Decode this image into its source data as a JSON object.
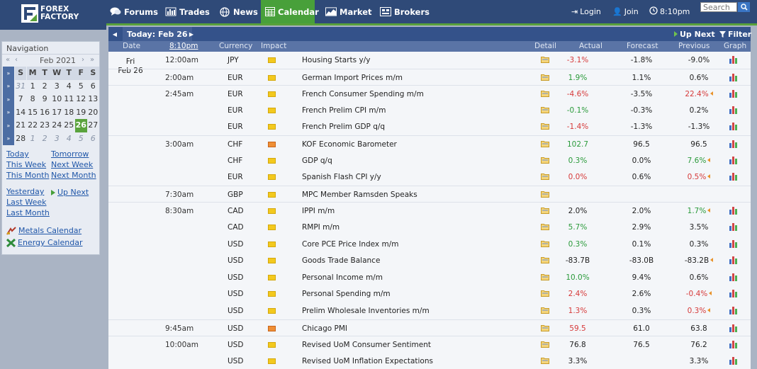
{
  "brand": {
    "line1": "FOREX",
    "line2": "FACTORY"
  },
  "nav": [
    {
      "label": "Forums",
      "icon": "chat-icon"
    },
    {
      "label": "Trades",
      "icon": "trades-icon"
    },
    {
      "label": "News",
      "icon": "globe-icon"
    },
    {
      "label": "Calendar",
      "icon": "calendar-icon",
      "active": true
    },
    {
      "label": "Market",
      "icon": "market-icon"
    },
    {
      "label": "Brokers",
      "icon": "brokers-icon"
    }
  ],
  "topright": {
    "login": "Login",
    "join": "Join",
    "clock": "8:10pm",
    "search_placeholder": "Search"
  },
  "sidebar": {
    "title": "Navigation",
    "month": "Feb 2021",
    "prev_year": "«",
    "prev_month": "‹",
    "next_month": "›",
    "next_year": "»",
    "weekday_headers": [
      "S",
      "M",
      "T",
      "W",
      "T",
      "F",
      "S"
    ],
    "weeks": [
      [
        {
          "d": "31",
          "dim": true
        },
        {
          "d": "1"
        },
        {
          "d": "2"
        },
        {
          "d": "3"
        },
        {
          "d": "4"
        },
        {
          "d": "5"
        },
        {
          "d": "6"
        }
      ],
      [
        {
          "d": "7"
        },
        {
          "d": "8"
        },
        {
          "d": "9"
        },
        {
          "d": "10"
        },
        {
          "d": "11"
        },
        {
          "d": "12"
        },
        {
          "d": "13"
        }
      ],
      [
        {
          "d": "14"
        },
        {
          "d": "15"
        },
        {
          "d": "16"
        },
        {
          "d": "17"
        },
        {
          "d": "18"
        },
        {
          "d": "19"
        },
        {
          "d": "20"
        }
      ],
      [
        {
          "d": "21"
        },
        {
          "d": "22"
        },
        {
          "d": "23"
        },
        {
          "d": "24"
        },
        {
          "d": "25"
        },
        {
          "d": "26",
          "today": true
        },
        {
          "d": "27"
        }
      ],
      [
        {
          "d": "28"
        },
        {
          "d": "1",
          "dim": true
        },
        {
          "d": "2",
          "dim": true
        },
        {
          "d": "3",
          "dim": true
        },
        {
          "d": "4",
          "dim": true
        },
        {
          "d": "5",
          "dim": true
        },
        {
          "d": "6",
          "dim": true
        }
      ]
    ],
    "links": {
      "today": "Today",
      "tomorrow": "Tomorrow",
      "this_week": "This Week",
      "next_week": "Next Week",
      "this_month": "This Month",
      "next_month": "Next Month",
      "yesterday": "Yesterday",
      "up_next": "Up Next",
      "last_week": "Last Week",
      "last_month": "Last Month",
      "metals": "Metals Calendar",
      "energy": "Energy Calendar"
    }
  },
  "calendar": {
    "today_label": "Today: Feb 26",
    "up_next": "Up Next",
    "filter": "Filter",
    "columns": {
      "date": "Date",
      "time": "8:10pm",
      "currency": "Currency",
      "impact": "Impact",
      "detail": "Detail",
      "actual": "Actual",
      "forecast": "Forecast",
      "previous": "Previous",
      "graph": "Graph"
    },
    "day_name": "Fri",
    "day_date": "Feb 26",
    "rows": [
      {
        "time": "12:00am",
        "cur": "JPY",
        "impact": "low",
        "event": "Housing Starts y/y",
        "actual": "-3.1%",
        "actual_color": "neg",
        "forecast": "-1.8%",
        "previous": "-9.0%",
        "prev_color": "",
        "revised": false
      },
      {
        "time": "2:00am",
        "cur": "EUR",
        "impact": "low",
        "event": "German Import Prices m/m",
        "actual": "1.9%",
        "actual_color": "pos",
        "forecast": "1.1%",
        "previous": "0.6%",
        "prev_color": "",
        "revised": false
      },
      {
        "time": "2:45am",
        "cur": "EUR",
        "impact": "low",
        "event": "French Consumer Spending m/m",
        "actual": "-4.6%",
        "actual_color": "neg",
        "forecast": "-3.5%",
        "previous": "22.4%",
        "prev_color": "neg",
        "revised": true
      },
      {
        "time": "",
        "cur": "EUR",
        "impact": "low",
        "event": "French Prelim CPI m/m",
        "actual": "-0.1%",
        "actual_color": "pos",
        "forecast": "-0.3%",
        "previous": "0.2%",
        "prev_color": "",
        "revised": false
      },
      {
        "time": "",
        "cur": "EUR",
        "impact": "low",
        "event": "French Prelim GDP q/q",
        "actual": "-1.4%",
        "actual_color": "neg",
        "forecast": "-1.3%",
        "previous": "-1.3%",
        "prev_color": "",
        "revised": false
      },
      {
        "time": "3:00am",
        "cur": "CHF",
        "impact": "medium",
        "event": "KOF Economic Barometer",
        "actual": "102.7",
        "actual_color": "pos",
        "forecast": "96.5",
        "previous": "96.5",
        "prev_color": "",
        "revised": false
      },
      {
        "time": "",
        "cur": "CHF",
        "impact": "low",
        "event": "GDP q/q",
        "actual": "0.3%",
        "actual_color": "pos",
        "forecast": "0.0%",
        "previous": "7.6%",
        "prev_color": "pos",
        "revised": true
      },
      {
        "time": "",
        "cur": "EUR",
        "impact": "low",
        "event": "Spanish Flash CPI y/y",
        "actual": "0.0%",
        "actual_color": "neg",
        "forecast": "0.6%",
        "previous": "0.5%",
        "prev_color": "neg",
        "revised": true
      },
      {
        "time": "7:30am",
        "cur": "GBP",
        "impact": "low",
        "event": "MPC Member Ramsden Speaks",
        "actual": "",
        "actual_color": "",
        "forecast": "",
        "previous": "",
        "prev_color": "",
        "revised": false,
        "nograph": true
      },
      {
        "time": "8:30am",
        "cur": "CAD",
        "impact": "low",
        "event": "IPPI m/m",
        "actual": "2.0%",
        "actual_color": "",
        "forecast": "2.0%",
        "previous": "1.7%",
        "prev_color": "pos",
        "revised": true
      },
      {
        "time": "",
        "cur": "CAD",
        "impact": "low",
        "event": "RMPI m/m",
        "actual": "5.7%",
        "actual_color": "pos",
        "forecast": "2.9%",
        "previous": "3.5%",
        "prev_color": "",
        "revised": false
      },
      {
        "time": "",
        "cur": "USD",
        "impact": "low",
        "event": "Core PCE Price Index m/m",
        "actual": "0.3%",
        "actual_color": "pos",
        "forecast": "0.1%",
        "previous": "0.3%",
        "prev_color": "",
        "revised": false
      },
      {
        "time": "",
        "cur": "USD",
        "impact": "low",
        "event": "Goods Trade Balance",
        "actual": "-83.7B",
        "actual_color": "",
        "forecast": "-83.0B",
        "previous": "-83.2B",
        "prev_color": "",
        "revised": true
      },
      {
        "time": "",
        "cur": "USD",
        "impact": "low",
        "event": "Personal Income m/m",
        "actual": "10.0%",
        "actual_color": "pos",
        "forecast": "9.4%",
        "previous": "0.6%",
        "prev_color": "",
        "revised": false
      },
      {
        "time": "",
        "cur": "USD",
        "impact": "low",
        "event": "Personal Spending m/m",
        "actual": "2.4%",
        "actual_color": "neg",
        "forecast": "2.6%",
        "previous": "-0.4%",
        "prev_color": "neg",
        "revised": true
      },
      {
        "time": "",
        "cur": "USD",
        "impact": "low",
        "event": "Prelim Wholesale Inventories m/m",
        "actual": "1.3%",
        "actual_color": "neg",
        "forecast": "0.3%",
        "previous": "0.3%",
        "prev_color": "neg",
        "revised": true
      },
      {
        "time": "9:45am",
        "cur": "USD",
        "impact": "medium",
        "event": "Chicago PMI",
        "actual": "59.5",
        "actual_color": "neg",
        "forecast": "61.0",
        "previous": "63.8",
        "prev_color": "",
        "revised": false
      },
      {
        "time": "10:00am",
        "cur": "USD",
        "impact": "low",
        "event": "Revised UoM Consumer Sentiment",
        "actual": "76.8",
        "actual_color": "",
        "forecast": "76.5",
        "previous": "76.2",
        "prev_color": "",
        "revised": false
      },
      {
        "time": "",
        "cur": "USD",
        "impact": "low",
        "event": "Revised UoM Inflation Expectations",
        "actual": "3.3%",
        "actual_color": "",
        "forecast": "",
        "previous": "3.3%",
        "prev_color": "",
        "revised": false
      }
    ]
  }
}
